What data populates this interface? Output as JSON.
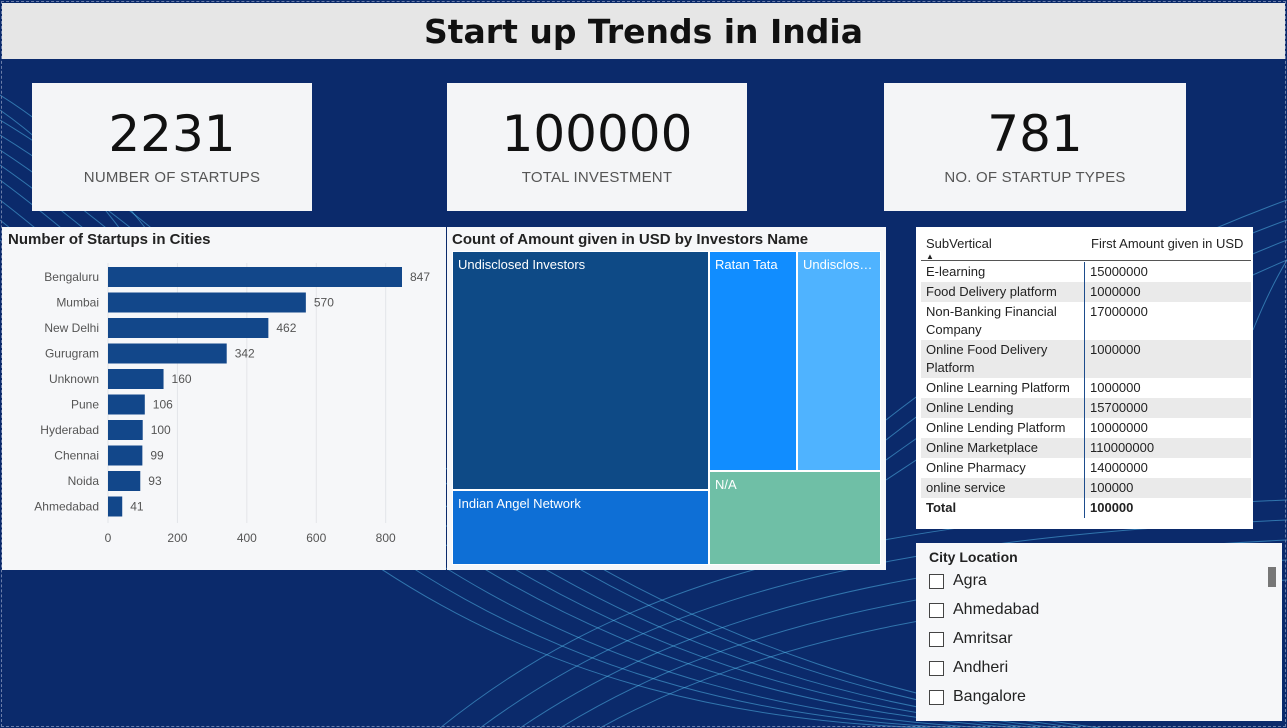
{
  "title": "Start up Trends in India",
  "kpis": [
    {
      "value": "2231",
      "label": "NUMBER OF STARTUPS"
    },
    {
      "value": "100000",
      "label": "TOTAL INVESTMENT"
    },
    {
      "value": "781",
      "label": "NO. OF STARTUP TYPES"
    }
  ],
  "bar_chart": {
    "title": "Number of Startups in Cities"
  },
  "treemap": {
    "title": "Count of Amount given in USD by Investors Name",
    "tiles": [
      {
        "label": "Undisclosed Investors",
        "color": "#0e4a86"
      },
      {
        "label": "Ratan Tata",
        "color": "#118dff"
      },
      {
        "label": "Undisclosed Investors",
        "color": "#4fb3ff"
      },
      {
        "label": "Indian Angel Network",
        "color": "#0e6fd6"
      },
      {
        "label": "N/A",
        "color": "#6fbfa6"
      }
    ]
  },
  "table": {
    "col1_header": "SubVertical",
    "col2_header": "First Amount given in USD",
    "sort_icon": "sort-ascending-icon",
    "rows": [
      {
        "subvertical": "E-learning",
        "amount": "15000000"
      },
      {
        "subvertical": "Food Delivery platform",
        "amount": "1000000"
      },
      {
        "subvertical": "Non-Banking Financial Company",
        "amount": "17000000"
      },
      {
        "subvertical": "Online Food Delivery Platform",
        "amount": "1000000"
      },
      {
        "subvertical": "Online Learning Platform",
        "amount": "1000000"
      },
      {
        "subvertical": "Online Lending",
        "amount": "15700000"
      },
      {
        "subvertical": "Online Lending Platform",
        "amount": "10000000"
      },
      {
        "subvertical": "Online Marketplace",
        "amount": "110000000"
      },
      {
        "subvertical": "Online Pharmacy",
        "amount": "14000000"
      },
      {
        "subvertical": "online service",
        "amount": "100000"
      }
    ],
    "total_label": "Total",
    "total_value": "100000"
  },
  "slicer": {
    "title": "City Location",
    "items": [
      "Agra",
      "Ahmedabad",
      "Amritsar",
      "Andheri",
      "Bangalore"
    ]
  },
  "chart_data": {
    "type": "bar",
    "orientation": "horizontal",
    "title": "Number of Startups in Cities",
    "categories": [
      "Bengaluru",
      "Mumbai",
      "New Delhi",
      "Gurugram",
      "Unknown",
      "Pune",
      "Hyderabad",
      "Chennai",
      "Noida",
      "Ahmedabad"
    ],
    "values": [
      847,
      570,
      462,
      342,
      160,
      106,
      100,
      99,
      93,
      41
    ],
    "xticks": [
      0,
      200,
      400,
      600,
      800
    ],
    "xlim": [
      0,
      900
    ],
    "grid": true,
    "bar_color": "#12478a"
  }
}
